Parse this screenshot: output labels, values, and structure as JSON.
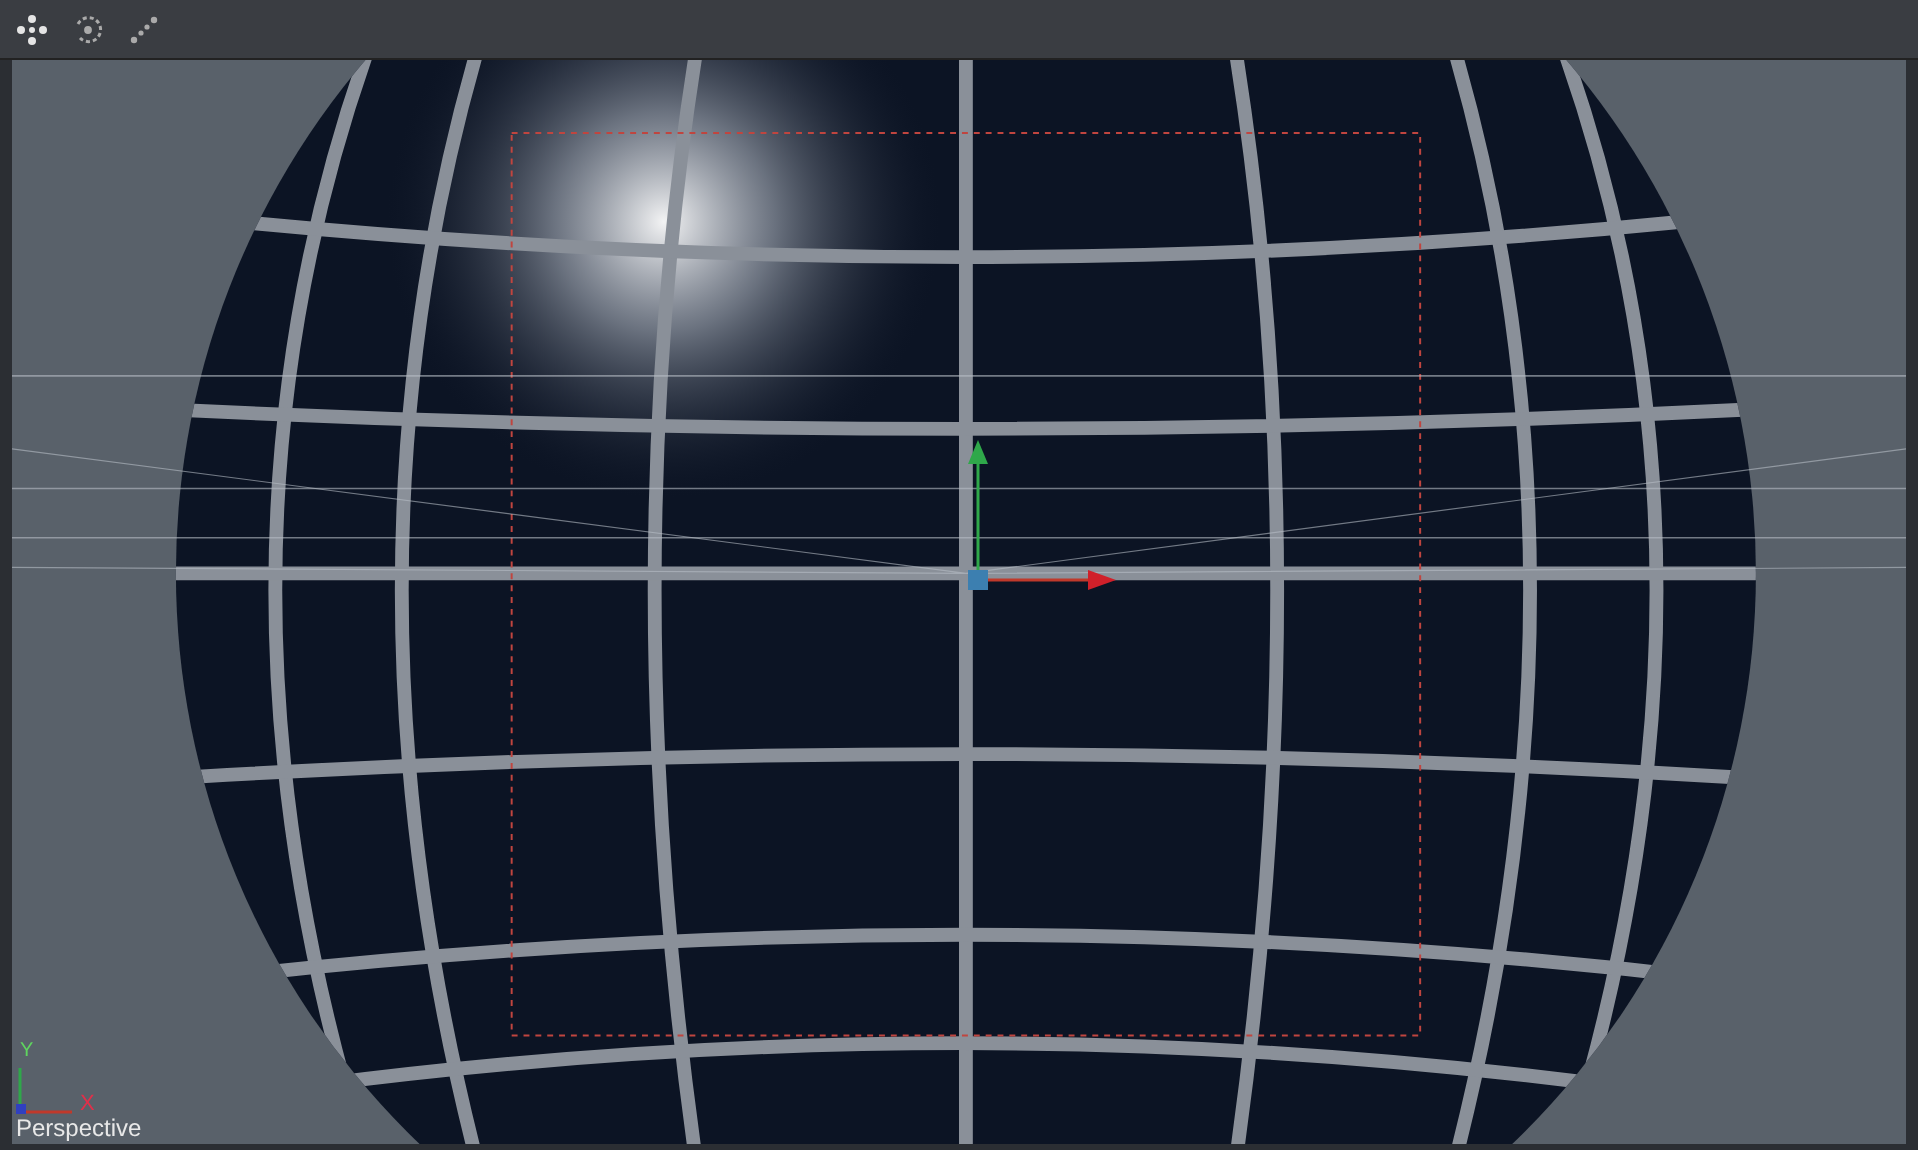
{
  "viewport": {
    "axis_labels": [
      "Y",
      "X"
    ],
    "camera_label": "Perspective"
  }
}
